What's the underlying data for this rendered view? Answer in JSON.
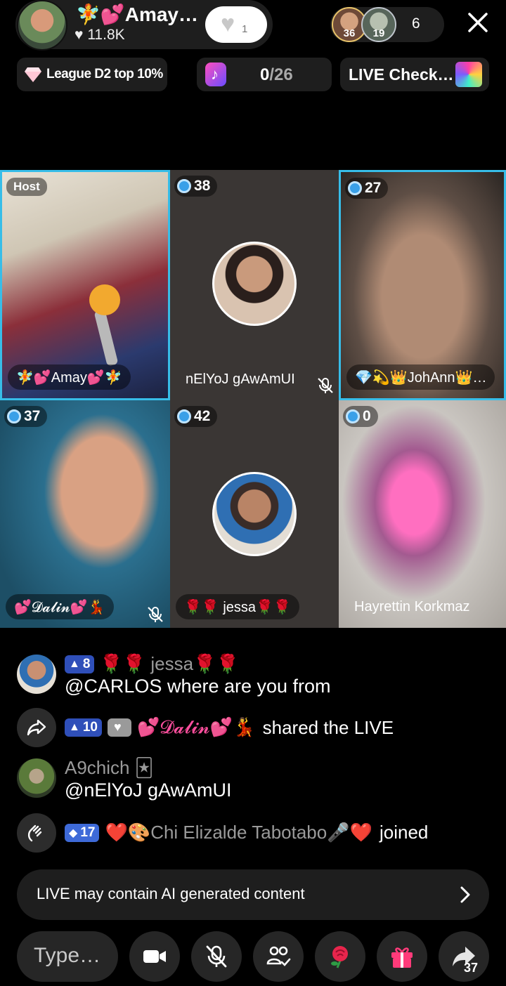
{
  "host": {
    "name": "🧚💕Amay…",
    "likes": "11.8K",
    "follow_count": "1"
  },
  "viewers": {
    "top1_level": "36",
    "top2_level": "19",
    "count": "6"
  },
  "chips": {
    "league": "League D2 top 10%",
    "goal_current": "0",
    "goal_total": "/26",
    "live_check": "LIVE Check…"
  },
  "grid": {
    "host_tag": "Host",
    "tiles": [
      {
        "name": "🧚💕Amay💕🧚"
      },
      {
        "score": "38",
        "name": "nElYoJ gAwAmUI"
      },
      {
        "score": "27",
        "name": "💎💫👑JohAnn👑…"
      },
      {
        "score": "37",
        "name": "💕𝓓𝓪𝓵𝓲𝓷💕💃"
      },
      {
        "score": "42",
        "name": "🌹🌹 jessa🌹🌹"
      },
      {
        "score": "0",
        "name": "Hayrettin Korkmaz"
      }
    ]
  },
  "chat": [
    {
      "level": "8",
      "user": "🌹🌹 jessa🌹🌹",
      "text": "@CARLOS where are you from"
    },
    {
      "level": "10",
      "user": "💕𝓓𝓪𝓵𝓲𝓷💕💃",
      "text": "shared the LIVE"
    },
    {
      "user": "A9chich 🃏",
      "text": "@nElYoJ gAwAmUI"
    },
    {
      "level": "17",
      "user": "❤️🎨Chi Elizalde Tabotabo🎤❤️",
      "text": "joined"
    }
  ],
  "ai_notice": "LIVE may contain AI generated content",
  "composer": {
    "placeholder": "Type…",
    "share_count": "37"
  },
  "icons": {
    "close": "close-icon",
    "video": "video-camera-icon",
    "mic_off": "mic-off-icon",
    "guests": "multi-guest-icon",
    "rose": "rose-gift-icon",
    "gift": "gift-box-icon",
    "share": "share-arrow-icon"
  },
  "colors": {
    "active_tile_border": "#37bde8",
    "level_badge": "#2f4fb9",
    "background": "#000000"
  }
}
